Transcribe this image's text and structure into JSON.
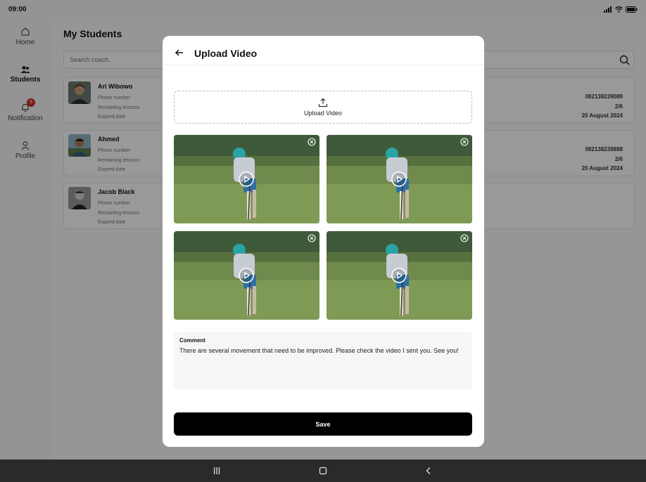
{
  "status_bar": {
    "time": "09:00"
  },
  "sidebar": {
    "items": [
      {
        "label": "Home",
        "icon": "home-icon"
      },
      {
        "label": "Students",
        "icon": "students-icon"
      },
      {
        "label": "Notification",
        "icon": "bell-icon",
        "badge": "3"
      },
      {
        "label": "Profile",
        "icon": "profile-icon"
      }
    ]
  },
  "main": {
    "title": "My Students",
    "search_placeholder": "Search coach...",
    "students": [
      {
        "name": "Ari Wibowo",
        "phone_label": "Phone number",
        "lessons_label": "Remaining lessons",
        "expired_label": "Expired date",
        "phone": "082138239089",
        "lessons": "2/6",
        "expired": "20 August 2024"
      },
      {
        "name": "Ahmed",
        "phone_label": "Phone number",
        "lessons_label": "Remaining lessons",
        "expired_label": "Expired date",
        "phone": "082138239888",
        "lessons": "2/6",
        "expired": "20 August 2024"
      },
      {
        "name": "Jacob Black",
        "phone_label": "Phone number",
        "lessons_label": "Remaining lessons",
        "expired_label": "Expired date",
        "phone": "",
        "lessons": "",
        "expired": ""
      }
    ]
  },
  "modal": {
    "title": "Upload Video",
    "upload_label": "Upload Video",
    "videos": [
      {
        "thumbnail": "golfer-putting"
      },
      {
        "thumbnail": "golfer-putting"
      },
      {
        "thumbnail": "golfer-putting"
      },
      {
        "thumbnail": "golfer-putting"
      }
    ],
    "comment_label": "Comment",
    "comment_text": "There are several movement that need to be improved. Please check the video I sent you. See you!",
    "save_label": "Save"
  },
  "colors": {
    "accent": "#000000",
    "badge": "#d92d2d",
    "overlay": "rgba(0,0,0,0.4)"
  }
}
